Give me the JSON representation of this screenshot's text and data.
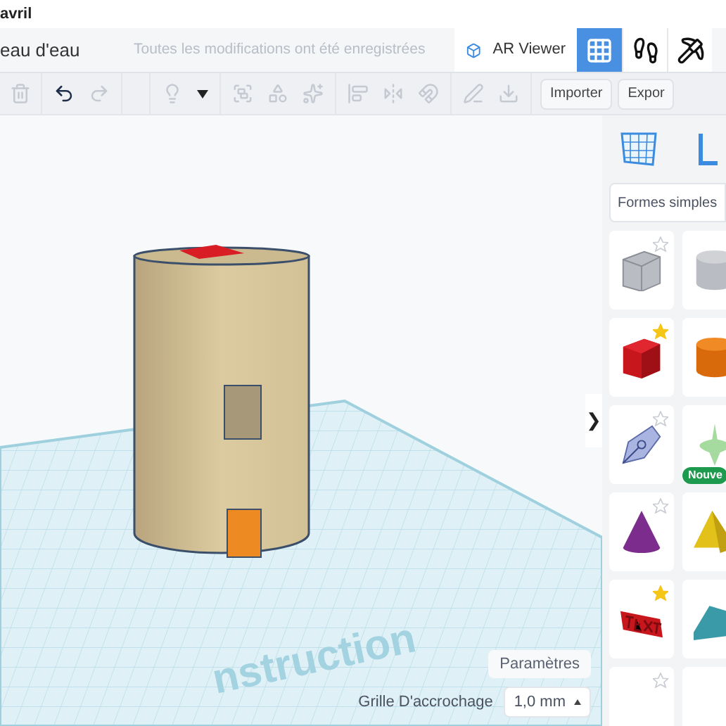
{
  "breadcrumb": "avril",
  "title": "eau d'eau",
  "save_status": "Toutes les modifications ont été enregistrées",
  "ar_viewer": {
    "label": "AR Viewer"
  },
  "view_buttons": [
    {
      "kind": "grid",
      "selected": true
    },
    {
      "kind": "bricks",
      "selected": false
    },
    {
      "kind": "blocks",
      "selected": false
    }
  ],
  "toolbar": {
    "import_button": "Importer",
    "export_button": "Expor"
  },
  "canvas": {
    "workplane_label": "nstruction",
    "settings_button": "Paramètres",
    "snap_grid": {
      "label": "Grille D'accrochage",
      "value": "1,0 mm"
    }
  },
  "panel": {
    "collapse_toggle": "❯",
    "category": "Formes simples",
    "shapes": [
      {
        "kind": "box-hole",
        "favorite": false
      },
      {
        "kind": "cylinder-hole"
      },
      {
        "kind": "box",
        "favorite": true
      },
      {
        "kind": "cylinder"
      },
      {
        "kind": "scribble",
        "favorite": false
      },
      {
        "kind": "revolver",
        "badge": "Nouve"
      },
      {
        "kind": "cone",
        "favorite": false
      },
      {
        "kind": "pyramid"
      },
      {
        "kind": "text",
        "favorite": true
      },
      {
        "kind": "roof"
      },
      {
        "kind": "blank",
        "favorite": false
      },
      {
        "kind": "blank"
      }
    ]
  }
}
